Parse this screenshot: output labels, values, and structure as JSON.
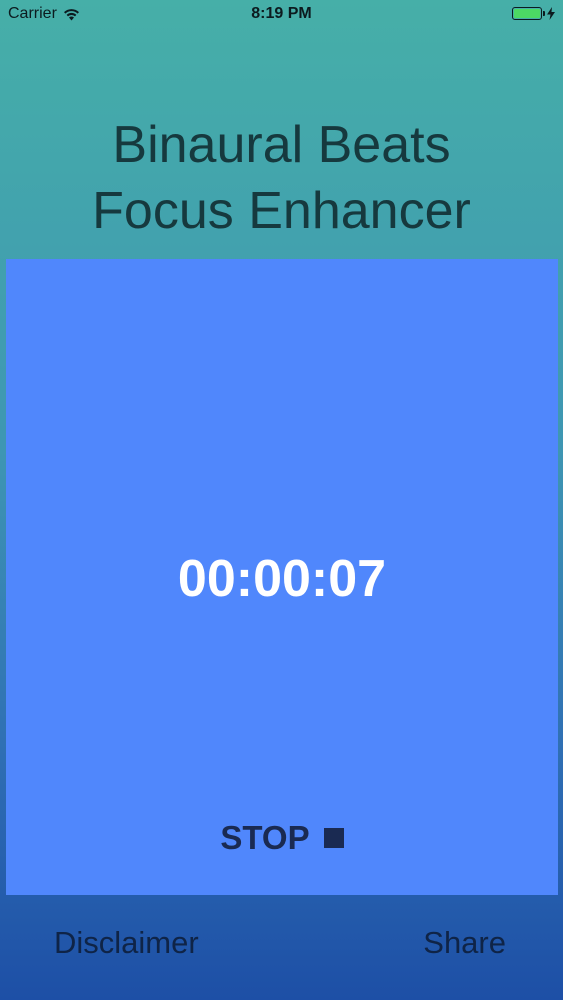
{
  "status_bar": {
    "carrier": "Carrier",
    "time": "8:19 PM",
    "battery_level": 1.0,
    "wifi_icon": "wifi-icon",
    "charging_icon": "bolt-icon"
  },
  "app": {
    "title_line1": "Binaural Beats",
    "title_line2": "Focus Enhancer"
  },
  "timer": {
    "elapsed": "00:00:07",
    "stop_label": "STOP",
    "stop_icon": "stop-icon",
    "panel_color": "#5087fc"
  },
  "bottom_bar": {
    "disclaimer_label": "Disclaimer",
    "share_label": "Share"
  }
}
